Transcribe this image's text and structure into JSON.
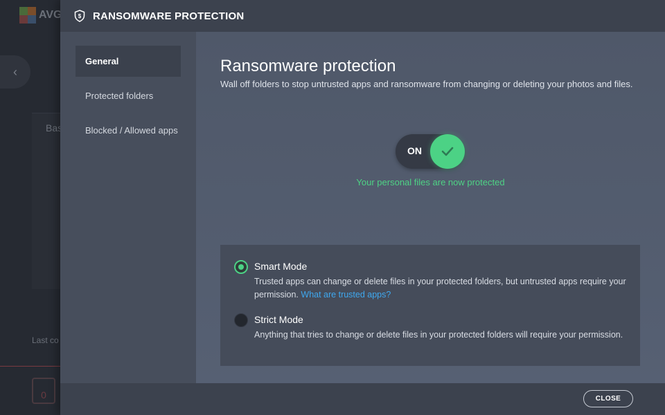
{
  "background_app": {
    "logo_text": "AVG",
    "card_title": "Bas",
    "last_label": "Last co",
    "calendar_value": "0"
  },
  "dialog": {
    "title": "RANSOMWARE PROTECTION",
    "title_icon": "shield-icon"
  },
  "sidebar": {
    "items": [
      {
        "label": "General",
        "active": true
      },
      {
        "label": "Protected folders",
        "active": false
      },
      {
        "label": "Blocked / Allowed apps",
        "active": false
      }
    ]
  },
  "main": {
    "title": "Ransomware protection",
    "subtitle": "Wall off folders to stop untrusted apps and ransomware from changing or deleting your photos and files.",
    "toggle": {
      "label": "ON",
      "state": true,
      "icon": "check-icon"
    },
    "status": "Your personal files are now protected",
    "modes": [
      {
        "title": "Smart Mode",
        "description": "Trusted apps can change or delete files in your protected folders, but untrusted apps require your permission.",
        "link": "What are trusted apps?",
        "selected": true
      },
      {
        "title": "Strict Mode",
        "description": "Anything that tries to change or delete files in your protected folders will require your permission.",
        "selected": false
      }
    ]
  },
  "footer": {
    "close_label": "CLOSE"
  },
  "colors": {
    "accent_green": "#4cd285",
    "link_blue": "#3fa8ef",
    "dialog_bg": "#515a6b",
    "titlebar_bg": "#3c424e"
  }
}
